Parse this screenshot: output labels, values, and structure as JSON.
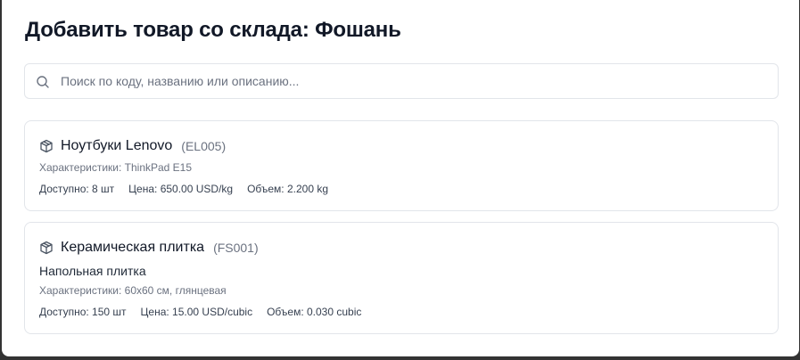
{
  "modal": {
    "title": "Добавить товар со склада: Фошань"
  },
  "search": {
    "placeholder": "Поиск по коду, названию или описанию...",
    "value": ""
  },
  "products": [
    {
      "name": "Ноутбуки Lenovo",
      "code": "(EL005)",
      "description": "",
      "specs": "Характеристики: ThinkPad E15",
      "available": "Доступно: 8 шт",
      "price": "Цена: 650.00 USD/kg",
      "volume": "Объем: 2.200 kg",
      "icon": "package-icon"
    },
    {
      "name": "Керамическая плитка",
      "code": "(FS001)",
      "description": "Напольная плитка",
      "specs": "Характеристики: 60х60 см, глянцевая",
      "available": "Доступно: 150 шт",
      "price": "Цена: 15.00 USD/cubic",
      "volume": "Объем: 0.030 cubic",
      "icon": "package-icon"
    }
  ],
  "colors": {
    "title": "#111827",
    "border": "#e2e5ea",
    "muted": "#6b7280",
    "backdrop": "#333333"
  }
}
